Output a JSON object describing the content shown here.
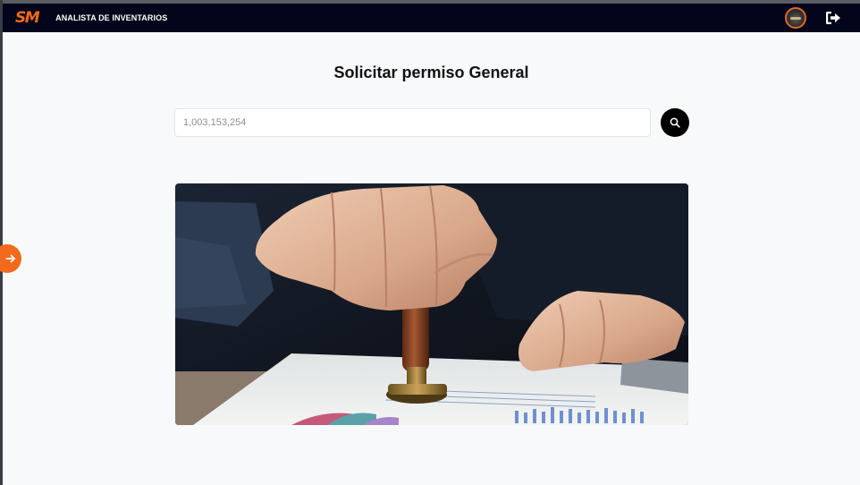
{
  "header": {
    "logo_text": "SM",
    "role_label": "ANALISTA DE INVENTARIOS",
    "avatar_icon": "user-avatar",
    "logout_icon": "logout-icon"
  },
  "main": {
    "title": "Solicitar permiso General",
    "search": {
      "placeholder": "1,003,153,254",
      "value": ""
    },
    "search_button_icon": "search-icon",
    "hero_image": "hand-stamping-document-image"
  },
  "sidebar_toggle": {
    "icon": "arrow-right-icon"
  },
  "colors": {
    "topbar": "#03061a",
    "accent": "#f26a1b",
    "background": "#f8f9fb"
  }
}
